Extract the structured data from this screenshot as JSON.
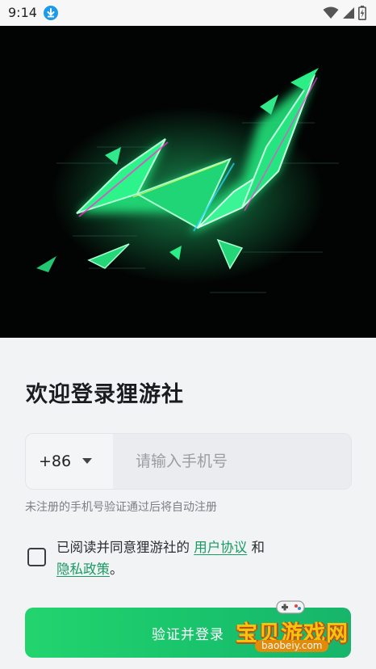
{
  "status_bar": {
    "time": "9:14",
    "icons": [
      "download-icon",
      "wifi-icon",
      "cellular-icon",
      "battery-icon"
    ]
  },
  "login": {
    "title": "欢迎登录狸游社",
    "country_code": "+86",
    "phone_placeholder": "请输入手机号",
    "hint": "未注册的手机号验证通过后将自动注册",
    "agreement_prefix": "已阅读并同意狸游社的 ",
    "user_agreement": "用户协议",
    "agreement_and": " 和",
    "privacy_policy": "隐私政策",
    "agreement_suffix": "。",
    "submit_label": "验证并登录"
  },
  "watermark": {
    "name": "宝贝游戏网",
    "url": "baobeiy.com"
  },
  "colors": {
    "accent": "#19c36c",
    "link": "#189a63",
    "hero_bg": "#020303"
  }
}
